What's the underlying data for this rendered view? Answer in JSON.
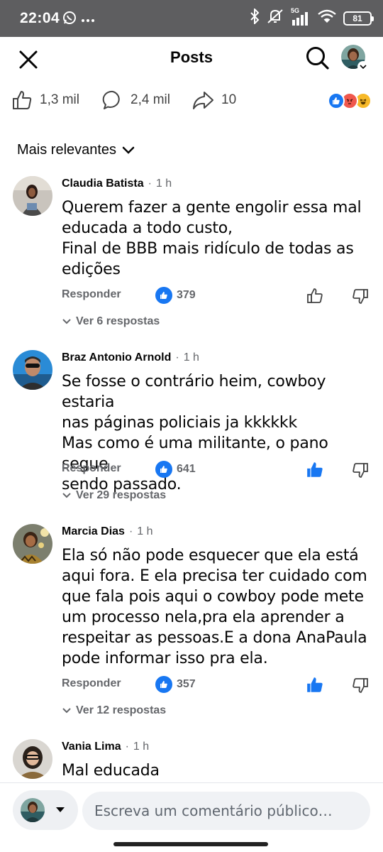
{
  "status_bar": {
    "time": "22:04",
    "left_icons": [
      "whatsapp-icon",
      "more-dots-icon"
    ],
    "right_icons": [
      "bluetooth-icon",
      "mute-icon",
      "signal-5g-icon",
      "wifi-icon"
    ],
    "network_label": "5G",
    "battery": "81"
  },
  "header": {
    "title": "Posts",
    "icons": [
      "close-icon",
      "search-icon",
      "profile-avatar"
    ]
  },
  "post_stats": {
    "likes": "1,3 mil",
    "comments": "2,4 mil",
    "shares": "10",
    "reactions": [
      "like",
      "angry",
      "haha"
    ],
    "colors": {
      "like": "#1877f2",
      "angry": "#f0584d",
      "haha": "#f7b928"
    }
  },
  "sort": {
    "label": "Mais relevantes"
  },
  "comments": [
    {
      "name": "Claudia Batista",
      "time": "1 h",
      "text": "Querem fazer a gente engolir essa mal\neducada a todo custo,\nFinal de BBB mais ridículo de todas as\nedições",
      "reply_label": "Responder",
      "likes": "379",
      "liked": false,
      "replies": "Ver 6 respostas"
    },
    {
      "name": "Braz Antonio Arnold",
      "time": "1 h",
      "text": "Se fosse o contrário heim, cowboy estaria\nnas páginas policiais ja kkkkkk\nMas como é uma militante, o pano segue\nsendo passado.",
      "reply_label": "Responder",
      "likes": "641",
      "liked": true,
      "replies": "Ver 29 respostas"
    },
    {
      "name": "Marcia Dias",
      "time": "1 h",
      "text": "Ela só não pode esquecer que ela está\naqui fora. E ela precisa ter cuidado com\nque fala pois aqui o cowboy pode mete\num processo  nela,pra ela aprender a\nrespeitar as pessoas.E a dona AnaPaula\npode informar isso pra ela.",
      "reply_label": "Responder",
      "likes": "357",
      "liked": true,
      "replies": "Ver 12 respostas"
    },
    {
      "name": "Vania Lima",
      "time": "1 h",
      "text": "Mal educada"
    }
  ],
  "composer": {
    "placeholder": "Escreva um comentário público…"
  },
  "accent_color": "#1877f2"
}
